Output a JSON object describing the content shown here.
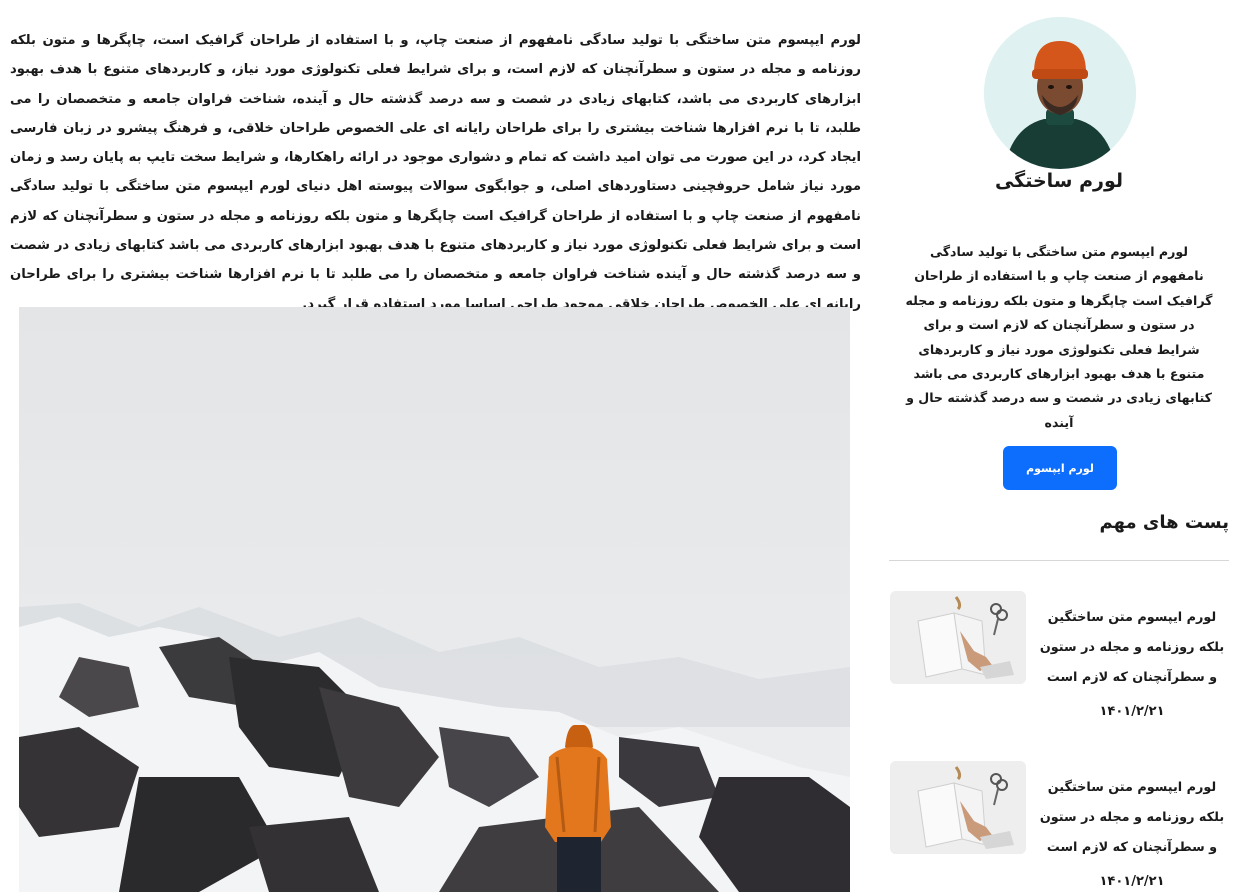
{
  "article": {
    "body": "لورم ایپسوم متن ساختگی با تولید سادگی نامفهوم از صنعت چاپ، و با استفاده از طراحان گرافیک است، چاپگرها و متون بلکه روزنامه و مجله در ستون و سطرآنچنان که لازم است، و برای شرایط فعلی تکنولوژی مورد نیاز، و کاربردهای متنوع با هدف بهبود ابزارهای کاربردی می باشد، کتابهای زیادی در شصت و سه درصد گذشته حال و آینده، شناخت فراوان جامعه و متخصصان را می طلبد، تا با نرم افزارها شناخت بیشتری را برای طراحان رایانه ای علی الخصوص طراحان خلاقی، و فرهنگ پیشرو در زبان فارسی ایجاد کرد، در این صورت می توان امید داشت که تمام و دشواری موجود در ارائه راهکارها، و شرایط سخت تایپ به پایان رسد و زمان مورد نیاز شامل حروفچینی دستاوردهای اصلی، و جوابگوی سوالات پیوسته اهل دنیای لورم ایپسوم متن ساختگی با تولید سادگی نامفهوم از صنعت چاپ و با استفاده از طراحان گرافیک است چاپگرها و متون بلکه روزنامه و مجله در ستون و سطرآنچنان که لازم است و برای شرایط فعلی تکنولوژی مورد نیاز و کاربردهای متنوع با هدف بهبود ابزارهای کاربردی می باشد کتابهای زیادی در شصت و سه درصد گذشته حال و آینده شناخت فراوان جامعه و متخصصان را می طلبد تا با نرم افزارها شناخت بیشتری را برای طراحان رایانه ای علی الخصوص طراحان خلاقی موجود طراحی اساسا مورد استفاده قرار گیرد.",
    "photo_icon": "mountain-photo"
  },
  "sidebar": {
    "avatar_icon": "author-avatar",
    "author_name": "لورم ساختگی",
    "bio": "لورم ایپسوم متن ساختگی با تولید سادگی نامفهوم از صنعت چاپ و با استفاده از طراحان گرافیک است چاپگرها و متون بلکه روزنامه و مجله در ستون و سطرآنچنان که لازم است و برای شرایط فعلی تکنولوژی مورد نیاز و کاربردهای متنوع با هدف بهبود ابزارهای کاربردی می باشد کتابهای زیادی در شصت و سه درصد گذشته حال و آینده",
    "button_label": "لورم ایپسوم",
    "section_title": "پست های مهم",
    "posts": [
      {
        "title": "لورم ایپسوم متن ساختگین بلکه روزنامه و مجله در ستون و سطرآنچنان که لازم است",
        "date": "۱۴۰۱/۲/۲۱",
        "thumb_icon": "notebook-thumbnail"
      },
      {
        "title": "لورم ایپسوم متن ساختگین بلکه روزنامه و مجله در ستون و سطرآنچنان که لازم است",
        "date": "۱۴۰۱/۲/۲۱",
        "thumb_icon": "notebook-thumbnail"
      }
    ]
  },
  "colors": {
    "accent": "#0d6efd",
    "text": "#1a1a1a",
    "divider": "#d7d7d7",
    "jacket": "#e2771d"
  }
}
